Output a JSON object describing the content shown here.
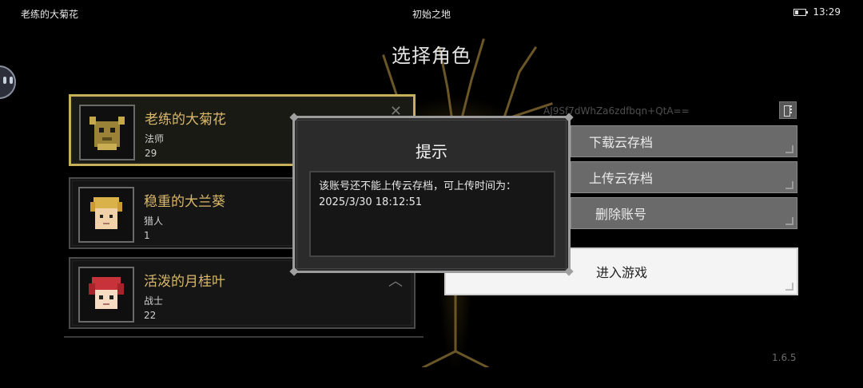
{
  "status_bar": {
    "left_text": "老练的大菊花",
    "center_text": "初始之地",
    "time": "13:29",
    "battery_icon": "battery-low-icon"
  },
  "screen_title": "选择角色",
  "characters": [
    {
      "name": "老练的大菊花",
      "class": "法师",
      "level": "29",
      "selected": true,
      "portrait_icon": "golden-horned-mask-icon"
    },
    {
      "name": "稳重的大兰葵",
      "class": "猎人",
      "level": "1",
      "selected": false,
      "portrait_icon": "blonde-hunter-icon"
    },
    {
      "name": "活泼的月桂叶",
      "class": "战士",
      "level": "22",
      "selected": false,
      "portrait_icon": "red-haired-warrior-icon"
    }
  ],
  "account_id": "AJ9Sf7dWhZa6zdfbqn+QtA==",
  "buttons": {
    "download": "下载云存档",
    "upload": "上传云存档",
    "delete": "删除账号",
    "enter": "进入游戏"
  },
  "version": "1.6.5",
  "dialog": {
    "title": "提示",
    "message_line1": "该账号还不能上传云存档，可上传时间为：",
    "message_line2": "2025/3/30 18:12:51"
  },
  "colors": {
    "accent_gold": "#c6b15a",
    "name_gold": "#d9b86a",
    "button_gray": "#6a6a6a",
    "enter_button": "#f4f4f4"
  }
}
